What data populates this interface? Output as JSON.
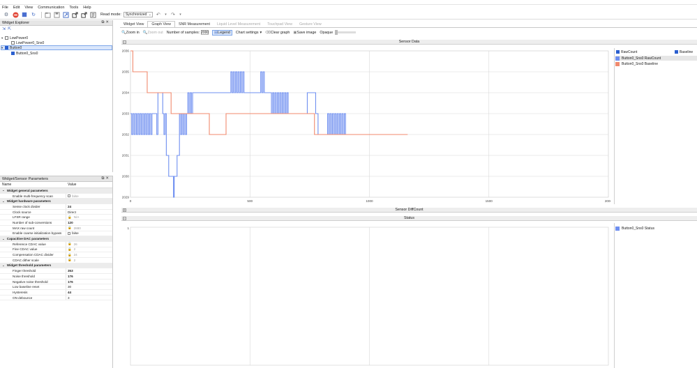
{
  "titlebar": {
    "text": ""
  },
  "menu": [
    "File",
    "Edit",
    "View",
    "Communication",
    "Tools",
    "Help"
  ],
  "toolbar": {
    "icons": [
      "settings-icon",
      "stop-icon",
      "pause-icon",
      "refresh-icon",
      "open-icon",
      "save-icon",
      "export-icon",
      "import-icon",
      "log-icon"
    ],
    "read_mode_label": "Read mode:",
    "read_mode_value": "Synchronized"
  },
  "explorer": {
    "title": "Widget Explorer",
    "items": [
      {
        "label": "LowPower0",
        "level": 0,
        "checked": false
      },
      {
        "label": "LowPower0_Sns0",
        "level": 1,
        "checked": false
      },
      {
        "label": "Button0",
        "level": 0,
        "checked": true,
        "selected": true
      },
      {
        "label": "Button0_Sns0",
        "level": 1,
        "checked": true
      }
    ]
  },
  "params": {
    "title": "Widget/Sensor Parameters",
    "col_name": "Name",
    "col_value": "Value",
    "rows": [
      {
        "name": "Widget general parameters",
        "group": true
      },
      {
        "name": "Enable multi-frequency scan",
        "value": "false",
        "style": "dim",
        "checkbox": true
      },
      {
        "name": "Widget hardware parameters",
        "group": true
      },
      {
        "name": "Sense clock divider",
        "value": "24",
        "style": "bold"
      },
      {
        "name": "Clock source",
        "value": "Direct",
        "style": ""
      },
      {
        "name": "LFSR range",
        "value": "N/A",
        "style": "dim",
        "lock": true
      },
      {
        "name": "Number of sub-conversions",
        "value": "120",
        "style": "bold"
      },
      {
        "name": "MAX raw count",
        "value": "2880",
        "style": "dim",
        "lock": true
      },
      {
        "name": "Enable coarse initialization bypass",
        "value": "false",
        "style": "",
        "checkbox": true
      },
      {
        "name": "Capacitive DAC parameters",
        "group": true
      },
      {
        "name": "Reference CDAC value",
        "value": "26",
        "style": "dim",
        "lock": true
      },
      {
        "name": "Fine CDAC value",
        "value": "2",
        "style": "dim",
        "lock": true
      },
      {
        "name": "Compensation CDAC divider",
        "value": "24",
        "style": "dim",
        "lock": true
      },
      {
        "name": "CDAC dither scale",
        "value": "2",
        "style": "dim",
        "lock": true
      },
      {
        "name": "Widget threshold parameters",
        "group": true
      },
      {
        "name": "Finger threshold",
        "value": "353",
        "style": "bold"
      },
      {
        "name": "Noise threshold",
        "value": "176",
        "style": "bold"
      },
      {
        "name": "Negative noise threshold",
        "value": "176",
        "style": "bold"
      },
      {
        "name": "Low baseline reset",
        "value": "30",
        "style": ""
      },
      {
        "name": "Hysteresis",
        "value": "44",
        "style": "bold"
      },
      {
        "name": "ON debounce",
        "value": "3",
        "style": ""
      }
    ]
  },
  "tabs": [
    {
      "label": "Widget View",
      "state": "normal"
    },
    {
      "label": "Graph View",
      "state": "active"
    },
    {
      "label": "SNR Measurement",
      "state": "normal"
    },
    {
      "label": "Liquid Level Measurement",
      "state": "dim"
    },
    {
      "label": "Touchpad View",
      "state": "dim"
    },
    {
      "label": "Gesture View",
      "state": "dim"
    }
  ],
  "graphbar": {
    "zoom_in": "Zoom in",
    "zoom_out": "Zoom out",
    "samples_label": "Number of samples:",
    "samples_value": "2000",
    "legend": "Legend",
    "chart_settings": "Chart settings",
    "clear_graph": "Clear graph",
    "save_image": "Save image",
    "opaque": "Opaque"
  },
  "sections": {
    "sensor_data": "Sensor Data",
    "sensor_diffcount": "Sensor DiffCount",
    "status": "Status"
  },
  "legend1": {
    "raw_toggle": "RawCount",
    "baseline_toggle": "Baseline",
    "entries": [
      "Button0_Sns0 RawCount",
      "Button0_Sns0 Baseline"
    ]
  },
  "legend2": {
    "entries": [
      "Button0_Sns0 Status"
    ]
  },
  "colors": {
    "raw": "#6f8ff0",
    "baseline": "#f08a6e",
    "grid": "#d8d8d8",
    "selection": "#d9e6fb"
  },
  "chart_data": [
    {
      "type": "line",
      "title": "Sensor Data",
      "xlim": [
        0,
        2000
      ],
      "ylim": [
        2029,
        2036
      ],
      "x_ticks": [
        0,
        500,
        1000,
        1500,
        2000
      ],
      "y_ticks": [
        2029,
        2030,
        2031,
        2032,
        2033,
        2034,
        2035,
        2036
      ],
      "grid": true,
      "series": [
        {
          "name": "Button0_Sns0 RawCount",
          "color": "#6f8ff0",
          "segments": [
            {
              "x": [
                0,
                95
              ],
              "kind": "osc",
              "low": 2032,
              "high": 2033
            },
            {
              "x": [
                95,
                105
              ],
              "kind": "flat",
              "y": 2033
            },
            {
              "x": [
                105,
                115
              ],
              "kind": "osc",
              "low": 2032,
              "high": 2033
            },
            {
              "x": [
                115,
                135
              ],
              "kind": "flat",
              "y": 2034
            },
            {
              "x": [
                135,
                150
              ],
              "kind": "osc",
              "low": 2032,
              "high": 2033
            },
            {
              "x": [
                150,
                160
              ],
              "kind": "flat",
              "y": 2031
            },
            {
              "x": [
                160,
                175
              ],
              "kind": "flat",
              "y": 2030
            },
            {
              "x": [
                175,
                183
              ],
              "kind": "osc",
              "low": 2029,
              "high": 2030
            },
            {
              "x": [
                183,
                195
              ],
              "kind": "flat",
              "y": 2030
            },
            {
              "x": [
                195,
                205
              ],
              "kind": "flat",
              "y": 2031
            },
            {
              "x": [
                205,
                240
              ],
              "kind": "osc",
              "low": 2032,
              "high": 2033
            },
            {
              "x": [
                240,
                260
              ],
              "kind": "osc",
              "low": 2033,
              "high": 2034
            },
            {
              "x": [
                260,
                420
              ],
              "kind": "flat",
              "y": 2034
            },
            {
              "x": [
                420,
                480
              ],
              "kind": "osc",
              "low": 2034,
              "high": 2035
            },
            {
              "x": [
                480,
                545
              ],
              "kind": "flat",
              "y": 2034
            },
            {
              "x": [
                545,
                560
              ],
              "kind": "osc",
              "low": 2034,
              "high": 2035
            },
            {
              "x": [
                560,
                585
              ],
              "kind": "flat",
              "y": 2034
            },
            {
              "x": [
                585,
                665
              ],
              "kind": "osc",
              "low": 2033,
              "high": 2034
            },
            {
              "x": [
                665,
                740
              ],
              "kind": "flat",
              "y": 2033
            },
            {
              "x": [
                740,
                775
              ],
              "kind": "flat",
              "y": 2034
            },
            {
              "x": [
                775,
                785
              ],
              "kind": "flat",
              "y": 2033
            },
            {
              "x": [
                785,
                795
              ],
              "kind": "flat",
              "y": 2032
            },
            {
              "x": [
                795,
                825
              ],
              "kind": "flat",
              "y": 2032
            },
            {
              "x": [
                825,
                900
              ],
              "kind": "osc",
              "low": 2032,
              "high": 2033
            },
            {
              "x": [
                900,
                950
              ],
              "kind": "flat",
              "y": 2032
            }
          ]
        },
        {
          "name": "Button0_Sns0 Baseline",
          "color": "#f08a6e",
          "steps": [
            [
              0,
              2036
            ],
            [
              10,
              2035
            ],
            [
              70,
              2034
            ],
            [
              170,
              2033
            ],
            [
              330,
              2032
            ],
            [
              400,
              2033
            ],
            [
              525,
              2033
            ],
            [
              670,
              2033
            ],
            [
              770,
              2032
            ],
            [
              1160,
              2032
            ]
          ]
        }
      ]
    },
    {
      "type": "line",
      "title": "Status",
      "ylim": [
        0,
        1
      ],
      "y_ticks": [
        1
      ],
      "grid": true,
      "series": [
        {
          "name": "Button0_Sns0 Status",
          "color": "#6f8ff0",
          "values": []
        }
      ]
    }
  ]
}
